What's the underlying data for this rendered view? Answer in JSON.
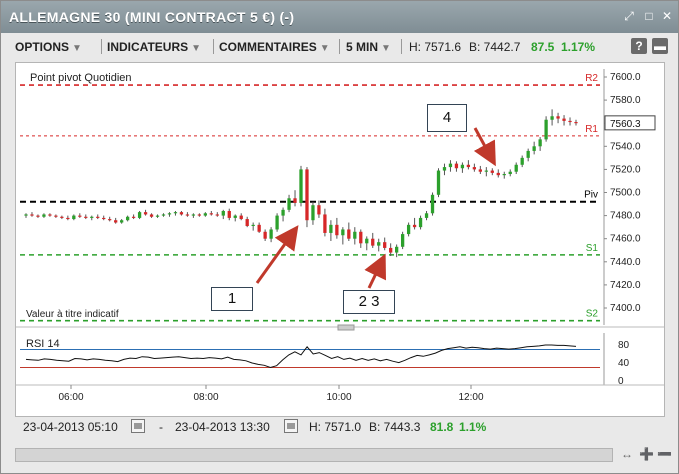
{
  "window": {
    "title": "ALLEMAGNE 30 (MINI CONTRACT 5 €) (-)",
    "icons": [
      "resize-icon",
      "minimize-icon",
      "close-icon"
    ]
  },
  "toolbar": {
    "options_label": "OPTIONS",
    "indicators_label": "INDICATEURS",
    "comments_label": "COMMENTAIRES",
    "timeframe_label": "5 MIN",
    "high_label": "H: 7571.6",
    "bid_label": "B: 7442.7",
    "change_value": "87.5",
    "change_pct": "1.17%",
    "change_color": "#2ca02c",
    "help_label": "?"
  },
  "chart_data": {
    "type": "candlestick",
    "title": "Point pivot  Quotidien",
    "note": "Valeur à titre indicatif",
    "ylim": [
      7380,
      7620
    ],
    "yticks": [
      "7600.0",
      "7580.0",
      "7560.0",
      "7540.0",
      "7520.0",
      "7500.0",
      "7480.0",
      "7460.0",
      "7440.0",
      "7420.0",
      "7400.0"
    ],
    "xticks": [
      "06:00",
      "08:00",
      "10:00",
      "12:00"
    ],
    "current_price": "7560.3",
    "pivot_levels": [
      {
        "name": "R2",
        "value": 7593,
        "color": "#d62728"
      },
      {
        "name": "R1",
        "value": 7549,
        "color": "#d62728"
      },
      {
        "name": "Piv",
        "value": 7492,
        "color": "#000000"
      },
      {
        "name": "S1",
        "value": 7446,
        "color": "#2ca02c"
      },
      {
        "name": "S2",
        "value": 7389,
        "color": "#2ca02c"
      }
    ],
    "candles_ohlc": [
      [
        7480,
        7482,
        7478,
        7481
      ],
      [
        7481,
        7483,
        7479,
        7480
      ],
      [
        7480,
        7481,
        7478,
        7479
      ],
      [
        7479,
        7482,
        7478,
        7481
      ],
      [
        7481,
        7482,
        7479,
        7480
      ],
      [
        7480,
        7481,
        7478,
        7479
      ],
      [
        7479,
        7480,
        7477,
        7478
      ],
      [
        7478,
        7480,
        7476,
        7477
      ],
      [
        7477,
        7481,
        7476,
        7480
      ],
      [
        7480,
        7482,
        7478,
        7479
      ],
      [
        7479,
        7481,
        7477,
        7478
      ],
      [
        7478,
        7480,
        7476,
        7479
      ],
      [
        7479,
        7481,
        7477,
        7478
      ],
      [
        7478,
        7480,
        7476,
        7477
      ],
      [
        7477,
        7479,
        7475,
        7476
      ],
      [
        7476,
        7478,
        7473,
        7474
      ],
      [
        7474,
        7477,
        7473,
        7476
      ],
      [
        7476,
        7480,
        7475,
        7479
      ],
      [
        7479,
        7481,
        7477,
        7478
      ],
      [
        7478,
        7484,
        7477,
        7483
      ],
      [
        7483,
        7485,
        7480,
        7481
      ],
      [
        7481,
        7482,
        7478,
        7479
      ],
      [
        7479,
        7481,
        7478,
        7480
      ],
      [
        7480,
        7482,
        7479,
        7481
      ],
      [
        7481,
        7483,
        7479,
        7482
      ],
      [
        7482,
        7484,
        7480,
        7483
      ],
      [
        7483,
        7484,
        7480,
        7481
      ],
      [
        7481,
        7483,
        7479,
        7480
      ],
      [
        7480,
        7482,
        7478,
        7481
      ],
      [
        7481,
        7482,
        7479,
        7480
      ],
      [
        7480,
        7483,
        7479,
        7482
      ],
      [
        7482,
        7484,
        7480,
        7481
      ],
      [
        7481,
        7483,
        7479,
        7480
      ],
      [
        7480,
        7485,
        7477,
        7484
      ],
      [
        7484,
        7486,
        7476,
        7478
      ],
      [
        7478,
        7481,
        7475,
        7480
      ],
      [
        7480,
        7482,
        7476,
        7477
      ],
      [
        7477,
        7479,
        7470,
        7471
      ],
      [
        7471,
        7474,
        7467,
        7472
      ],
      [
        7472,
        7474,
        7465,
        7466
      ],
      [
        7466,
        7468,
        7458,
        7460
      ],
      [
        7460,
        7470,
        7457,
        7468
      ],
      [
        7468,
        7482,
        7466,
        7480
      ],
      [
        7480,
        7487,
        7475,
        7485
      ],
      [
        7485,
        7498,
        7483,
        7495
      ],
      [
        7495,
        7502,
        7488,
        7491
      ],
      [
        7491,
        7523,
        7488,
        7520
      ],
      [
        7520,
        7522,
        7470,
        7476
      ],
      [
        7476,
        7492,
        7472,
        7489
      ],
      [
        7489,
        7493,
        7478,
        7481
      ],
      [
        7481,
        7486,
        7462,
        7465
      ],
      [
        7465,
        7476,
        7458,
        7472
      ],
      [
        7472,
        7478,
        7460,
        7463
      ],
      [
        7463,
        7470,
        7455,
        7468
      ],
      [
        7468,
        7474,
        7458,
        7460
      ],
      [
        7460,
        7470,
        7455,
        7466
      ],
      [
        7466,
        7468,
        7452,
        7456
      ],
      [
        7456,
        7462,
        7450,
        7460
      ],
      [
        7460,
        7465,
        7452,
        7454
      ],
      [
        7454,
        7460,
        7449,
        7457
      ],
      [
        7457,
        7461,
        7450,
        7452
      ],
      [
        7452,
        7456,
        7445,
        7448
      ],
      [
        7448,
        7455,
        7444,
        7453
      ],
      [
        7453,
        7466,
        7451,
        7464
      ],
      [
        7464,
        7474,
        7462,
        7472
      ],
      [
        7472,
        7478,
        7468,
        7470
      ],
      [
        7470,
        7480,
        7468,
        7478
      ],
      [
        7478,
        7484,
        7476,
        7482
      ],
      [
        7482,
        7500,
        7480,
        7498
      ],
      [
        7498,
        7521,
        7496,
        7519
      ],
      [
        7519,
        7525,
        7515,
        7522
      ],
      [
        7522,
        7528,
        7518,
        7525
      ],
      [
        7525,
        7527,
        7518,
        7521
      ],
      [
        7521,
        7526,
        7517,
        7524
      ],
      [
        7524,
        7528,
        7520,
        7522
      ],
      [
        7522,
        7525,
        7518,
        7520
      ],
      [
        7520,
        7523,
        7516,
        7518
      ],
      [
        7518,
        7522,
        7514,
        7519
      ],
      [
        7519,
        7521,
        7515,
        7517
      ],
      [
        7517,
        7520,
        7513,
        7515
      ],
      [
        7515,
        7518,
        7512,
        7516
      ],
      [
        7516,
        7520,
        7514,
        7518
      ],
      [
        7518,
        7526,
        7516,
        7524
      ],
      [
        7524,
        7532,
        7522,
        7530
      ],
      [
        7530,
        7538,
        7527,
        7536
      ],
      [
        7536,
        7544,
        7533,
        7540
      ],
      [
        7540,
        7548,
        7536,
        7546
      ],
      [
        7546,
        7566,
        7544,
        7563
      ],
      [
        7563,
        7572,
        7558,
        7566
      ],
      [
        7566,
        7569,
        7560,
        7564
      ],
      [
        7564,
        7567,
        7558,
        7562
      ],
      [
        7562,
        7565,
        7558,
        7561
      ],
      [
        7561,
        7563,
        7558,
        7560
      ]
    ],
    "rsi": {
      "label": "RSI  14",
      "ylim": [
        0,
        100
      ],
      "yticks": [
        "80",
        "40",
        "0"
      ],
      "levels": [
        {
          "value": 70,
          "color": "#2c6fb3"
        },
        {
          "value": 30,
          "color": "#c0392b"
        }
      ],
      "values": [
        48,
        47,
        46,
        49,
        48,
        46,
        45,
        44,
        50,
        49,
        47,
        49,
        48,
        46,
        45,
        43,
        48,
        51,
        50,
        54,
        53,
        50,
        51,
        52,
        53,
        54,
        52,
        50,
        51,
        50,
        52,
        51,
        49,
        53,
        48,
        47,
        45,
        40,
        37,
        35,
        30,
        34,
        47,
        58,
        65,
        58,
        76,
        60,
        63,
        57,
        50,
        54,
        48,
        51,
        46,
        50,
        46,
        49,
        45,
        48,
        44,
        41,
        46,
        52,
        57,
        55,
        58,
        62,
        68,
        72,
        74,
        76,
        73,
        75,
        74,
        72,
        71,
        73,
        72,
        71,
        72,
        74,
        76,
        77,
        78,
        80,
        80,
        79,
        79,
        78,
        77
      ]
    }
  },
  "annotations": [
    {
      "label": "1"
    },
    {
      "label": "2 3"
    },
    {
      "label": "4"
    }
  ],
  "footer": {
    "start_datetime": "23-04-2013 05:10",
    "range_sep": "-",
    "end_datetime": "23-04-2013 13:30",
    "high_label": "H: 7571.0",
    "bid_label": "B: 7443.3",
    "change_value": "81.8",
    "change_pct": "1.1%",
    "change_color": "#2ca02c"
  }
}
